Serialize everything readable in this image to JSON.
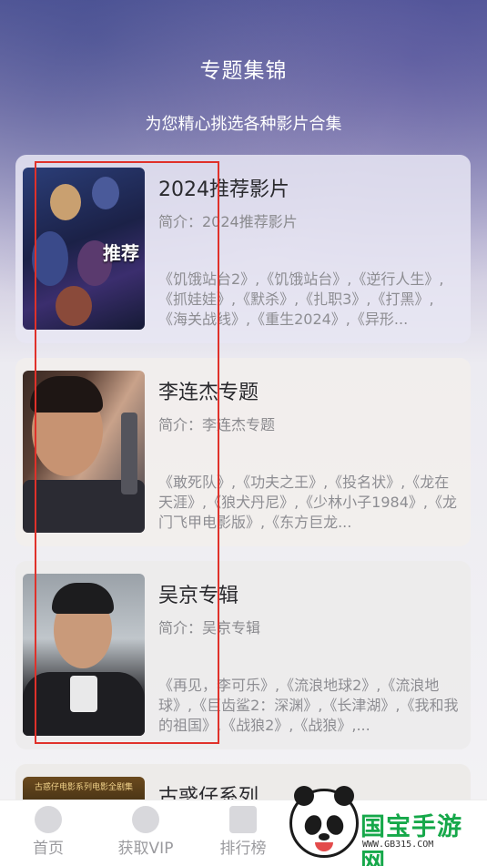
{
  "header": {
    "title": "专题集锦",
    "subtitle": "为您精心挑选各种影片合集"
  },
  "cards": [
    {
      "title": "2024推荐影片",
      "intro": "简介：2024推荐影片",
      "films": "《饥饿站台2》,《饥饿站台》,《逆行人生》,《抓娃娃》,《默杀》,《扎职3》,《打黑》,《海关战线》,《重生2024》,《异形...",
      "poster_text": "推荐"
    },
    {
      "title": "李连杰专题",
      "intro": "简介：李连杰专题",
      "films": "《敢死队》,《功夫之王》,《投名状》,《龙在天涯》,《狼犬丹尼》,《少林小子1984》,《龙门飞甲电影版》,《东方巨龙..."
    },
    {
      "title": "吴京专辑",
      "intro": "简介：吴京专辑",
      "films": "《再见，李可乐》,《流浪地球2》,《流浪地球》,《巨齿鲨2：深渊》,《长津湖》,《我和我的祖国》,《战狼2》,《战狼》,..."
    },
    {
      "title": "古惑仔系列",
      "poster_text": "古惑仔电影系列电影全剧集"
    }
  ],
  "tabs": [
    {
      "label": "首页",
      "icon": "home-icon"
    },
    {
      "label": "获取VIP",
      "icon": "vip-icon"
    },
    {
      "label": "排行榜",
      "icon": "chart-icon"
    }
  ],
  "watermark": {
    "brand": "国宝手游网",
    "url": "WWW.GB315.COM"
  },
  "colors": {
    "highlight": "#e0312a",
    "watermark_green": "#16a84a"
  }
}
